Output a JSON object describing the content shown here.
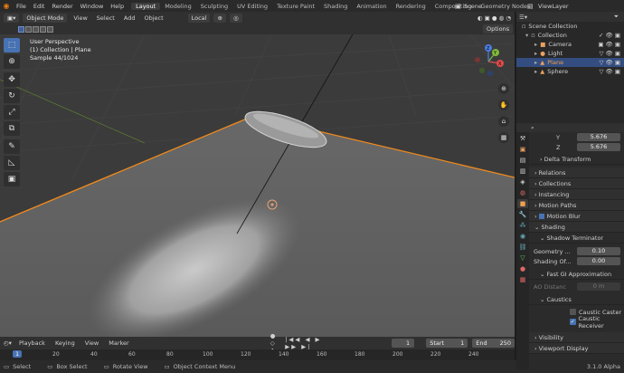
{
  "topbar": {
    "menus": [
      "File",
      "Edit",
      "Render",
      "Window",
      "Help"
    ],
    "workspaces": [
      "Layout",
      "Modeling",
      "Sculpting",
      "UV Editing",
      "Texture Paint",
      "Shading",
      "Animation",
      "Rendering",
      "Compositing",
      "Geometry Nodes"
    ],
    "active_workspace": "Layout",
    "scene": "Scene",
    "view_layer": "ViewLayer"
  },
  "viewport": {
    "mode": "Object Mode",
    "menus": [
      "View",
      "Select",
      "Add",
      "Object"
    ],
    "transform": "Local",
    "options_label": "Options",
    "overlay_lines": [
      "User Perspective",
      "(1) Collection | Plane",
      "Sample 44/1024"
    ],
    "gizmo_axes": {
      "x": "X",
      "y": "Y",
      "z": "Z"
    }
  },
  "outliner": {
    "root": "Scene Collection",
    "collection": "Collection",
    "items": [
      {
        "name": "Camera",
        "selected": false
      },
      {
        "name": "Light",
        "selected": false
      },
      {
        "name": "Plane",
        "selected": true
      },
      {
        "name": "Sphere",
        "selected": false
      }
    ]
  },
  "properties": {
    "y_label": "Y",
    "y_value": "5.676",
    "z_label": "Z",
    "z_value": "5.676",
    "panels": [
      "Delta Transform",
      "Relations",
      "Collections",
      "Instancing",
      "Motion Paths",
      "Motion Blur"
    ],
    "shading": "Shading",
    "shadow_terminator": "Shadow Terminator",
    "geometry_label": "Geometry ...",
    "geometry_value": "0.10",
    "shading_off_label": "Shading Of...",
    "shading_off_value": "0.00",
    "fast_gi": "Fast GI Approximation",
    "ao_label": "AO Distanc",
    "ao_value": "0 m",
    "caustics": "Caustics",
    "caustic_caster": "Caustic Caster",
    "caustic_receiver": "Caustic Receiver",
    "visibility": "Visibility",
    "viewport_display": "Viewport Display"
  },
  "timeline": {
    "menus": [
      "Playback",
      "Keying",
      "View",
      "Marker"
    ],
    "current_frame": "1",
    "start_label": "Start",
    "start": "1",
    "end_label": "End",
    "end": "250",
    "current_marker": "1",
    "ticks": [
      "20",
      "40",
      "60",
      "80",
      "100",
      "120",
      "140",
      "160",
      "180",
      "200",
      "220",
      "240"
    ]
  },
  "statusbar": {
    "select": "Select",
    "box_select": "Box Select",
    "rotate_view": "Rotate View",
    "context_menu": "Object Context Menu",
    "version": "3.1.0 Alpha"
  }
}
